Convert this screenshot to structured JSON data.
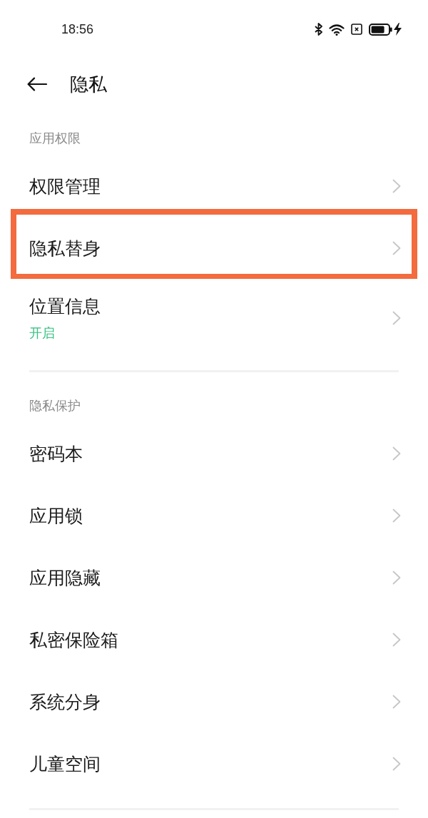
{
  "status_bar": {
    "time": "18:56"
  },
  "header": {
    "title": "隐私"
  },
  "sections": [
    {
      "title": "应用权限",
      "items": [
        {
          "label": "权限管理",
          "highlighted": false
        },
        {
          "label": "隐私替身",
          "highlighted": true
        },
        {
          "label": "位置信息",
          "status": "开启",
          "highlighted": false
        }
      ]
    },
    {
      "title": "隐私保护",
      "items": [
        {
          "label": "密码本",
          "highlighted": false
        },
        {
          "label": "应用锁",
          "highlighted": false
        },
        {
          "label": "应用隐藏",
          "highlighted": false
        },
        {
          "label": "私密保险箱",
          "highlighted": false
        },
        {
          "label": "系统分身",
          "highlighted": false
        },
        {
          "label": "儿童空间",
          "highlighted": false
        }
      ]
    }
  ]
}
